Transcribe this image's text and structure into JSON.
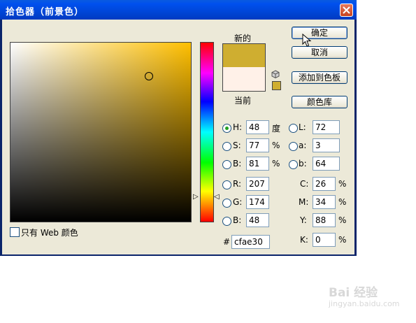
{
  "window": {
    "title": "拾色器（前景色）"
  },
  "buttons": {
    "ok": "确定",
    "cancel": "取消",
    "add_swatch": "添加到色板",
    "libraries": "颜色库"
  },
  "preview": {
    "new_label": "新的",
    "current_label": "当前",
    "new_color": "#cfae30",
    "current_color": "#fff1e8"
  },
  "hsb": {
    "h": {
      "label": "H:",
      "value": "48",
      "unit": "度"
    },
    "s": {
      "label": "S:",
      "value": "77",
      "unit": "%"
    },
    "b": {
      "label": "B:",
      "value": "81",
      "unit": "%"
    }
  },
  "rgb": {
    "r": {
      "label": "R:",
      "value": "207"
    },
    "g": {
      "label": "G:",
      "value": "174"
    },
    "b": {
      "label": "B:",
      "value": "48"
    }
  },
  "lab": {
    "l": {
      "label": "L:",
      "value": "72"
    },
    "a": {
      "label": "a:",
      "value": "3"
    },
    "b": {
      "label": "b:",
      "value": "64"
    }
  },
  "cmyk": {
    "c": {
      "label": "C:",
      "value": "26",
      "unit": "%"
    },
    "m": {
      "label": "M:",
      "value": "34",
      "unit": "%"
    },
    "y": {
      "label": "Y:",
      "value": "88",
      "unit": "%"
    },
    "k": {
      "label": "K:",
      "value": "0",
      "unit": "%"
    }
  },
  "hex": {
    "label": "#",
    "value": "cfae30"
  },
  "web_only": {
    "label": "只有 Web 颜色",
    "checked": false
  },
  "selected_mode": "H",
  "hue_base_color": "#ffbf00",
  "watermark": {
    "brand": "Bai 经验",
    "url": "jingyan.baidu.com"
  }
}
